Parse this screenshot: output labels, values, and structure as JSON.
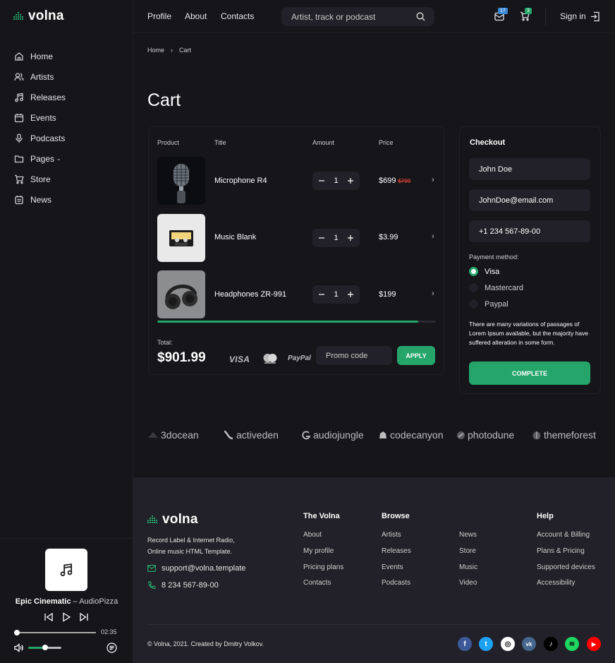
{
  "brand": {
    "name": "volna",
    "accent": "#25a56a",
    "bg": "#16151a",
    "panel": "#222028",
    "sale": "#e8463b"
  },
  "sidebar": {
    "items": [
      {
        "label": "Home",
        "icon": "home-icon"
      },
      {
        "label": "Artists",
        "icon": "users-icon"
      },
      {
        "label": "Releases",
        "icon": "music-note-icon"
      },
      {
        "label": "Events",
        "icon": "calendar-icon"
      },
      {
        "label": "Podcasts",
        "icon": "microphone-icon"
      },
      {
        "label": "Pages",
        "icon": "folder-icon"
      },
      {
        "label": "Store",
        "icon": "cart-icon"
      },
      {
        "label": "News",
        "icon": "news-icon"
      }
    ]
  },
  "player": {
    "artist": "Epic Cinematic",
    "separator": "–",
    "title": "AudioPizza",
    "time": "02:35",
    "progress": 0.02,
    "volume": 0.5
  },
  "header": {
    "links": [
      "Profile",
      "About",
      "Contacts"
    ],
    "search_placeholder": "Artist, track or podcast",
    "messages_count": "17",
    "cart_count": "3",
    "signin": "Sign in"
  },
  "breadcrumb": {
    "home": "Home",
    "sep": "›",
    "current": "Cart"
  },
  "page_title": "Cart",
  "cart": {
    "columns": [
      "Product",
      "Title",
      "Amount",
      "Price"
    ],
    "items": [
      {
        "title": "Microphone R4",
        "qty": "1",
        "price": "$699",
        "old_price": "$799"
      },
      {
        "title": "Music Blank",
        "qty": "1",
        "price": "$3.99",
        "old_price": ""
      },
      {
        "title": "Headphones ZR-991",
        "qty": "1",
        "price": "$199",
        "old_price": ""
      }
    ],
    "arrow": "›",
    "total_label": "Total:",
    "total": "$901.99",
    "payments": {
      "visa": "VISA",
      "paypal": "PayPal"
    },
    "promo_placeholder": "Promo code",
    "apply": "APPLY"
  },
  "checkout": {
    "title": "Checkout",
    "name": "John Doe",
    "email": "JohnDoe@email.com",
    "phone": "+1 234 567-89-00",
    "payment_label": "Payment method:",
    "methods": [
      "Visa",
      "Mastercard",
      "Paypal"
    ],
    "note": "There are many variations of passages of Lorem Ipsum available, but the majority have suffered alteration in some form.",
    "button": "COMPLETE"
  },
  "partners": [
    "3docean",
    "activeden",
    "audiojungle",
    "codecanyon",
    "photodune",
    "themeforest"
  ],
  "footer": {
    "brand": "volna",
    "desc": "Record Label & Internet Radio, Online music HTML Template.",
    "email": "support@volna.template",
    "phone": "8 234 567-89-00",
    "col1": {
      "title": "The Volna",
      "links": [
        "About",
        "My profile",
        "Pricing plans",
        "Contacts"
      ]
    },
    "col2": {
      "title": "Browse",
      "links": [
        "Artists",
        "Releases",
        "Events",
        "Podcasts"
      ]
    },
    "col3": {
      "links": [
        "News",
        "Store",
        "Music",
        "Video"
      ]
    },
    "col4": {
      "title": "Help",
      "links": [
        "Account & Billing",
        "Plans & Pricing",
        "Supported devices",
        "Accessibility"
      ]
    },
    "copyright": "© Volna, 2021. Created by Dmitry Volkov.",
    "social": [
      {
        "icon": "facebook-icon",
        "glyph": "f",
        "color": "#3b5999"
      },
      {
        "icon": "twitter-icon",
        "glyph": "t",
        "color": "#1da1f2"
      },
      {
        "icon": "instagram-icon",
        "glyph": "◎",
        "color": "#ffffff"
      },
      {
        "icon": "vk-icon",
        "glyph": "vk",
        "color": "#45668e"
      },
      {
        "icon": "tiktok-icon",
        "glyph": "♪",
        "color": "#000000"
      },
      {
        "icon": "spotify-icon",
        "glyph": "≋",
        "color": "#1ed760"
      },
      {
        "icon": "youtube-icon",
        "glyph": "▶",
        "color": "#ff0000"
      }
    ]
  }
}
